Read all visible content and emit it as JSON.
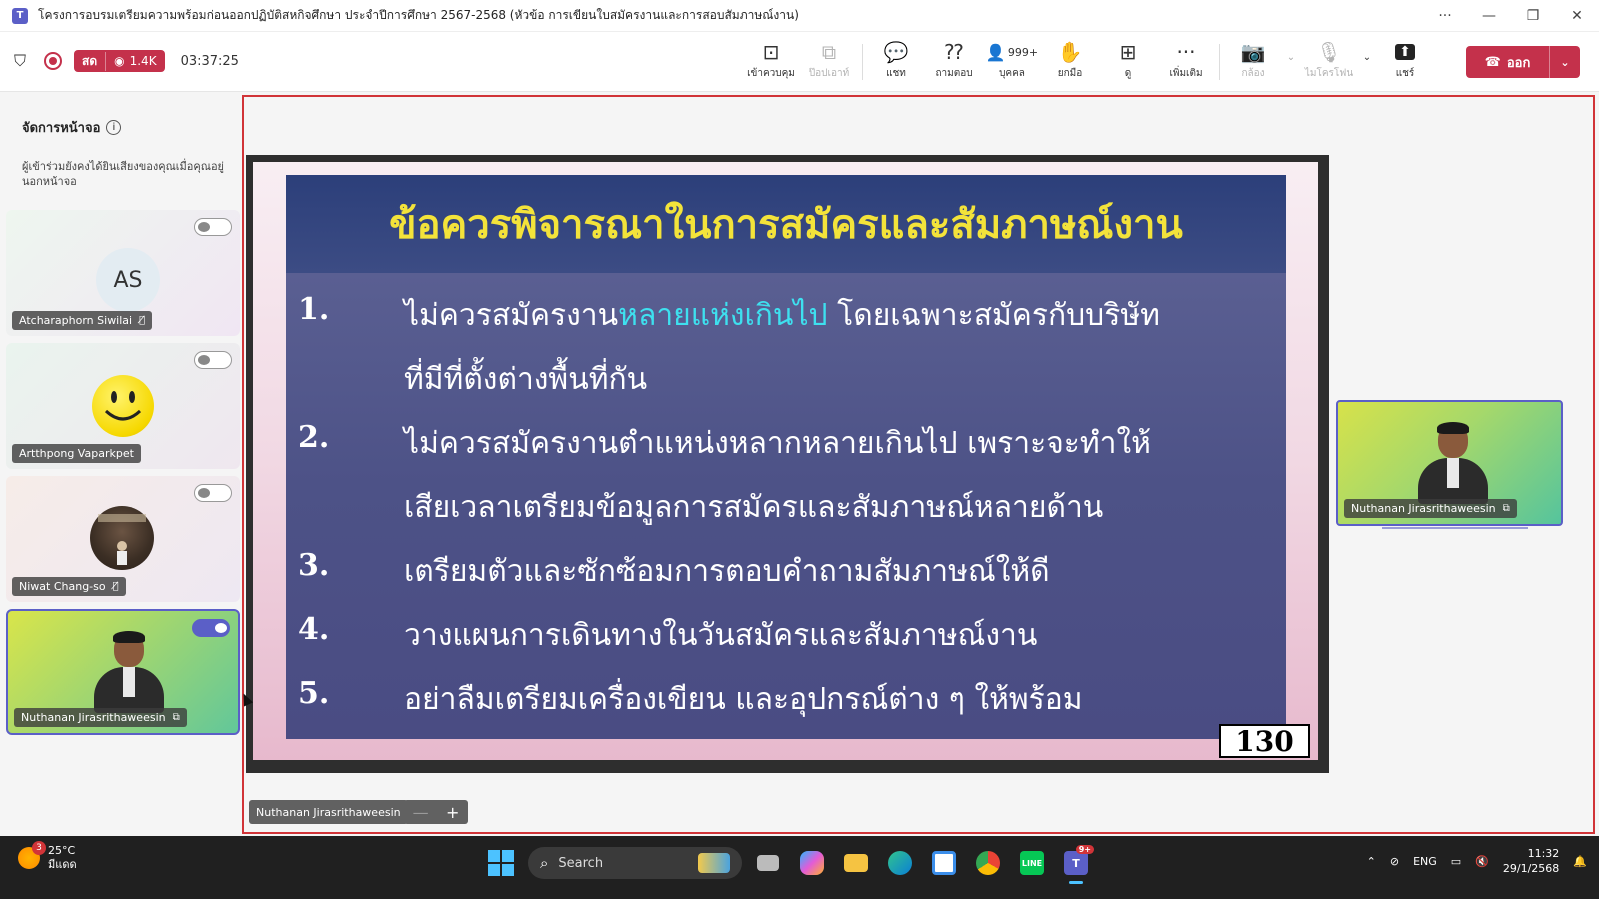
{
  "window": {
    "title": "โครงการอบรมเตรียมความพร้อมก่อนออกปฏิบัติสหกิจศึกษา ประจำปีการศึกษา 2567-2568 (หัวข้อ การเขียนใบสมัครงานและการสอบสัมภาษณ์งาน)",
    "more": "···",
    "minimize": "—",
    "restore": "❐",
    "close": "✕"
  },
  "meeting": {
    "live_label": "สด",
    "viewers": "1.4K",
    "timer": "03:37:25"
  },
  "toolbar": {
    "buttons": [
      {
        "label": "เข้าควบคุม",
        "icon": "⊡"
      },
      {
        "label": "ป๊อปเอาท์",
        "icon": "⧉"
      },
      {
        "label": "แชท",
        "icon": "💬"
      },
      {
        "label": "ถามตอบ",
        "icon": "⁇"
      },
      {
        "label": "บุคคล",
        "icon": "👤",
        "count": "999+"
      },
      {
        "label": "ยกมือ",
        "icon": "✋"
      },
      {
        "label": "ดู",
        "icon": "⊞"
      },
      {
        "label": "เพิ่มเติม",
        "icon": "···"
      },
      {
        "label": "กล้อง",
        "icon": "📷"
      },
      {
        "label": "ไมโครโฟน",
        "icon": "🎙"
      },
      {
        "label": "แชร์",
        "icon": "⬆"
      }
    ],
    "leave_label": "ออก"
  },
  "left_panel": {
    "title": "จัดการหน้าจอ",
    "description": "ผู้เข้าร่วมยังคงได้ยินเสียงของคุณเมื่อคุณอยู่นอกหน้าจอ",
    "participants": [
      {
        "name": "Atcharaphorn Siwilai",
        "initials": "AS",
        "toggle": "off"
      },
      {
        "name": "Artthpong Vaparkpet",
        "toggle": "off"
      },
      {
        "name": "Niwat Chang-so",
        "toggle": "off"
      },
      {
        "name": "Nuthanan Jirasrithaweesin",
        "toggle": "on"
      }
    ]
  },
  "slide": {
    "title": "ข้อควรพิจารณาในการสมัครและสัมภาษณ์งาน",
    "items": [
      {
        "num": "1.",
        "line1_pre": "ไม่ควรสมัครงาน",
        "line1_hl": "หลายแห่งเกินไป",
        "line1_post": " โดยเฉพาะสมัครกับบริษัท",
        "line2": "ที่มีที่ตั้งต่างพื้นที่กัน"
      },
      {
        "num": "2.",
        "line1": "ไม่ควรสมัครงานตำแหน่งหลากหลายเกินไป เพราะจะทำให้",
        "line2": "เสียเวลาเตรียมข้อมูลการสมัครและสัมภาษณ์หลายด้าน"
      },
      {
        "num": "3.",
        "line1": "เตรียมตัวและซักซ้อมการตอบคำถามสัมภาษณ์ให้ดี"
      },
      {
        "num": "4.",
        "line1": "วางแผนการเดินทางในวันสมัครและสัมภาษณ์งาน"
      },
      {
        "num": "5.",
        "line1": "อย่าลืมเตรียมเครื่องเขียน และอุปกรณ์ต่าง ๆ ให้พร้อม"
      }
    ],
    "page_number": "130"
  },
  "presenter": {
    "name": "Nuthanan Jirasrithaweesin",
    "zoom_minus": "—",
    "zoom_plus": "+"
  },
  "taskbar": {
    "weather_temp": "25°C",
    "weather_desc": "มีแดด",
    "weather_badge": "3",
    "search_label": "Search",
    "teams_badge": "9+",
    "lang": "ENG",
    "time": "11:32",
    "date": "29/1/2568"
  },
  "colors": {
    "accent": "#5b5fc7",
    "live_red": "#c4314b",
    "stage_border": "#d13438",
    "slide_title": "#f3e33a",
    "slide_highlight": "#3ee0ef"
  }
}
